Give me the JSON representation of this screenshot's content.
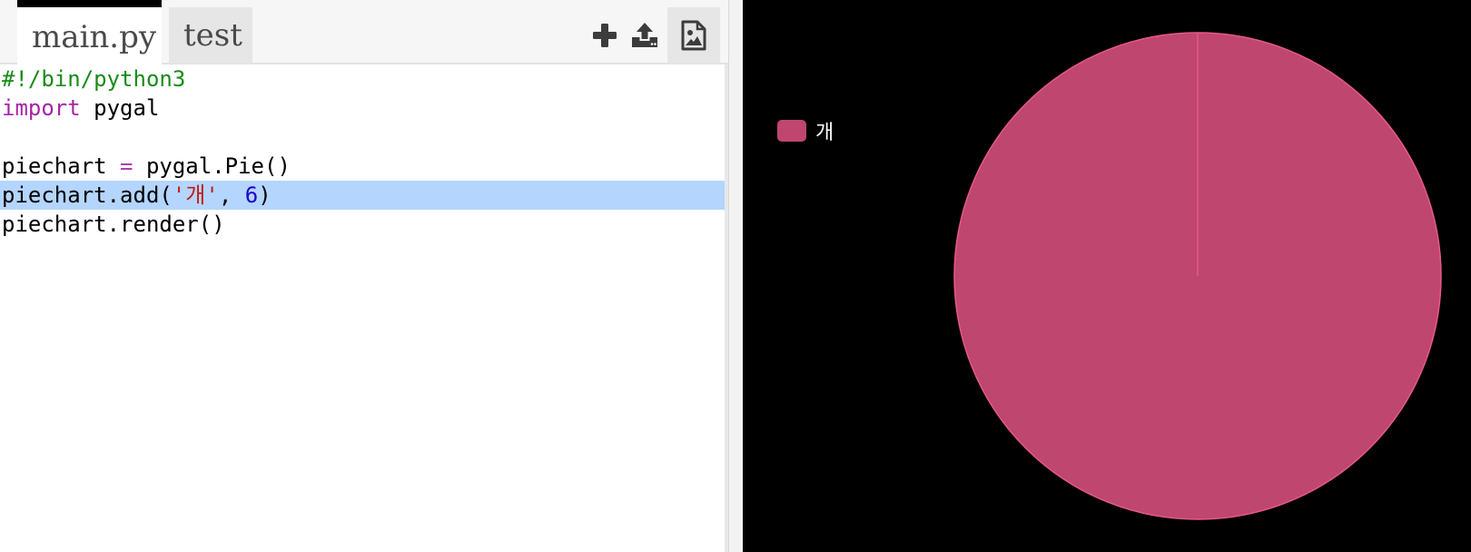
{
  "editor": {
    "tabs": [
      {
        "label": "main.py",
        "active": true
      },
      {
        "label": "test",
        "active": false
      }
    ],
    "toolbar": {
      "add_icon": "plus-icon",
      "upload_icon": "upload-icon",
      "image_icon": "image-file-icon"
    },
    "code": {
      "line1": "#!/bin/python3",
      "line2_kw": "import",
      "line2_rest": " pygal",
      "line4_a": "piechart ",
      "line4_op": "=",
      "line4_b": " pygal.Pie()",
      "line5_a": "piechart.add(",
      "line5_str": "'개'",
      "line5_b": ", ",
      "line5_num": "6",
      "line5_c": ")",
      "line6": "piechart.render()"
    }
  },
  "output": {
    "background": "#000000"
  },
  "chart_data": {
    "type": "pie",
    "categories": [
      "개"
    ],
    "values": [
      6
    ],
    "series": [
      {
        "name": "개",
        "values": [
          6
        ],
        "color": "#bf466f"
      }
    ],
    "legend": "left",
    "title": ""
  }
}
